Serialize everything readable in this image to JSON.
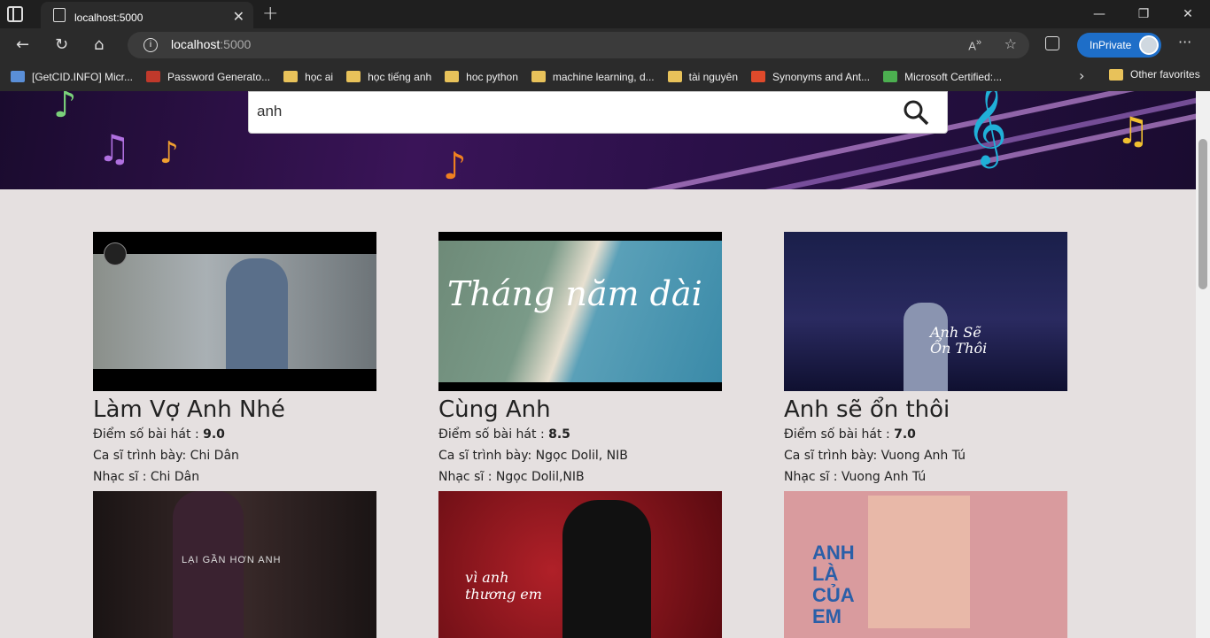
{
  "browser": {
    "tab_title": "localhost:5000",
    "url_host": "localhost",
    "url_port": ":5000",
    "inprivate_label": "InPrivate",
    "bookmarks": [
      {
        "label": "[GetCID.INFO] Micr...",
        "icon": "page-icon",
        "color": "#5a8fd8"
      },
      {
        "label": "Password Generato...",
        "icon": "password-icon",
        "color": "#c0392b"
      },
      {
        "label": "học ai",
        "icon": "folder-icon",
        "color": "#e8c25a"
      },
      {
        "label": "học tiếng anh",
        "icon": "folder-icon",
        "color": "#e8c25a"
      },
      {
        "label": "hoc python",
        "icon": "folder-icon",
        "color": "#e8c25a"
      },
      {
        "label": "machine learning, d...",
        "icon": "folder-icon",
        "color": "#e8c25a"
      },
      {
        "label": "tài nguyên",
        "icon": "folder-icon",
        "color": "#e8c25a"
      },
      {
        "label": "Synonyms and Ant...",
        "icon": "thesaurus-icon",
        "color": "#e04a2b"
      },
      {
        "label": "Microsoft Certified:...",
        "icon": "microsoft-icon",
        "color": "#4caf50"
      }
    ],
    "other_favorites": "Other favorites"
  },
  "search": {
    "value": "anh"
  },
  "songs": [
    {
      "title": "Làm Vợ Anh Nhé",
      "score_label": "Điểm số bài hát : ",
      "score": "9.0",
      "singer_label": "Ca sĩ trình bày: ",
      "singer": "Chi Dân",
      "composer_label": "Nhạc sĩ : ",
      "composer": "Chi Dân",
      "thumb_color": "#6b7a7e"
    },
    {
      "title": "Cùng Anh",
      "score_label": "Điểm số bài hát : ",
      "score": "8.5",
      "singer_label": "Ca sĩ trình bày: ",
      "singer": "Ngọc Dolil, NIB",
      "composer_label": "Nhạc sĩ : ",
      "composer": "Ngọc Dolil,NIB",
      "thumb_color": "#5b8a7a",
      "thumb_text": "Tháng năm dài"
    },
    {
      "title": "Anh sẽ ổn thôi",
      "score_label": "Điểm số bài hát : ",
      "score": "7.0",
      "singer_label": "Ca sĩ trình bày: ",
      "singer": "Vuong Anh Tú",
      "composer_label": "Nhạc sĩ : ",
      "composer": "Vuong Anh Tú",
      "thumb_color": "#1c2048",
      "thumb_text": "Anh Sẽ Ổn Thôi"
    },
    {
      "thumb_color": "#2a1e1e",
      "thumb_text": "LẠI GẦN HƠN ANH"
    },
    {
      "thumb_color": "#8a1a1e",
      "thumb_text": "vì anh thương em"
    },
    {
      "thumb_color": "#d9a0a0",
      "thumb_text": "ANH LÀ CỦA EM"
    }
  ]
}
